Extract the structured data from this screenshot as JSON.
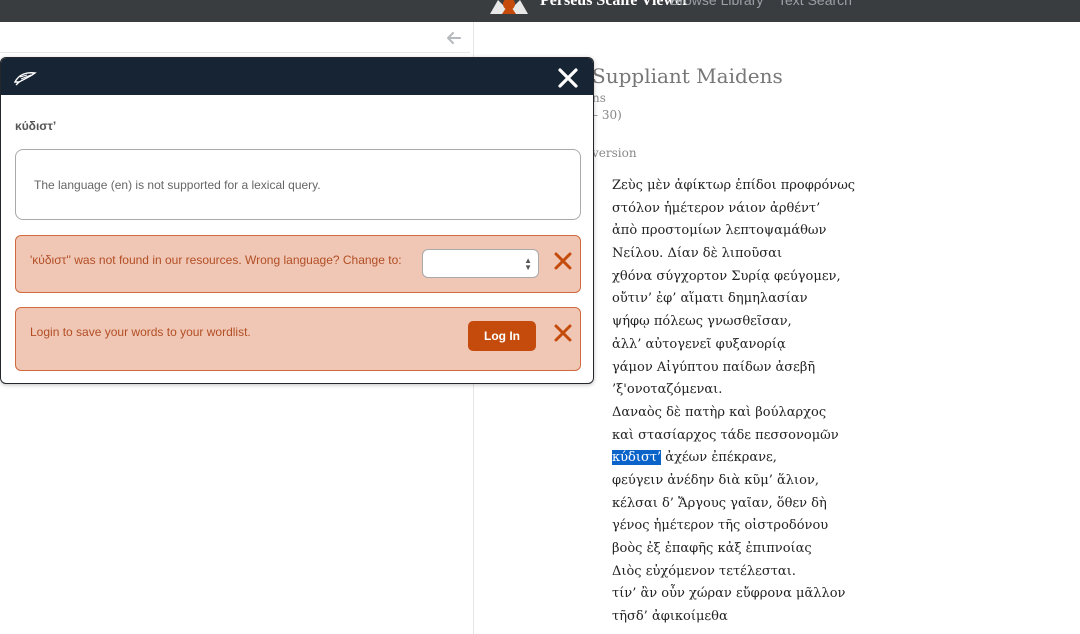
{
  "nav": {
    "brand": "Perseus Scaife Viewer",
    "browse_link": "Browse Library",
    "search_link": "Text Search"
  },
  "reader": {
    "title": "Suppliant Maidens",
    "subtitle_1": "ns",
    "subtitle_2": "– 30)",
    "version_label": "version",
    "lines": [
      "Ζεὺς μὲν ἀφίκτωρ ἐπίδοι προφρόνως",
      "στόλον ἡμέτερον νάιον ἀρθέντ’",
      "ἀπὸ προστομίων λεπτοψαμάθων",
      "Νείλου. Δίαν δὲ λιποῦσαι",
      "χθόνα σύγχορτον Συρίᾳ φεύγομεν,",
      "οὔτιν’ ἐφ’ αἵματι δημηλασίαν",
      "ψήφῳ πόλεως γνωσθεῖσαν,",
      "ἀλλ’ αὐτογενεῖ φυξανορίᾳ",
      "γάμον Αἰγύπτου παίδων ἀσεβῆ",
      "’ξ'ονοταζόμεναι.",
      "Δαναὸς δὲ πατὴρ καὶ βούλαρχος",
      "καὶ στασίαρχος τάδε πεσσονομῶν",
      "__HL__",
      "φεύγειν ἀνέδην διὰ κῦμ’ ἅλιον,",
      "κέλσαι δ’ Ἄργους γαῖαν, ὅθεν δὴ",
      "γένος ἡμέτερον τῆς οἰστροδόνου",
      "βοὸς ἐξ ἐπαφῆς κἀξ ἐπιπνοίας",
      "Διὸς εὐχόμενον τετέλεσται.",
      "τίν’ ἂν οὖν χώραν εὔφρονα μᾶλλον",
      "τῆσδ’ ἀφικοίμεθα"
    ],
    "highlight_word": "κύδιστ’",
    "highlight_line_rest": " ἀχέων ἐπέκρανε,"
  },
  "popup": {
    "lemma": "κύδιστ’",
    "info_message": "The language (en) is not supported for a lexical query.",
    "not_found_message": "'κύδιστ'' was not found in our resources. Wrong language? Change to:",
    "language_selected": "",
    "login_message": "Login to save your words to your wordlist.",
    "login_button": "Log In"
  },
  "colors": {
    "topnav": "#3a3d40",
    "popup_header": "#172433",
    "alert_bg": "#f0c7b5",
    "alert_border": "#d0693c",
    "alert_text": "#b24e25",
    "accent": "#c44b0c",
    "highlight": "#0a63c9"
  },
  "icons": {
    "back": "arrow-left-icon",
    "close": "close-icon",
    "dismiss": "dismiss-icon",
    "popup": "scroll-quill-icon",
    "logo": "perseus-logo-icon",
    "select": "select-arrows-icon"
  }
}
